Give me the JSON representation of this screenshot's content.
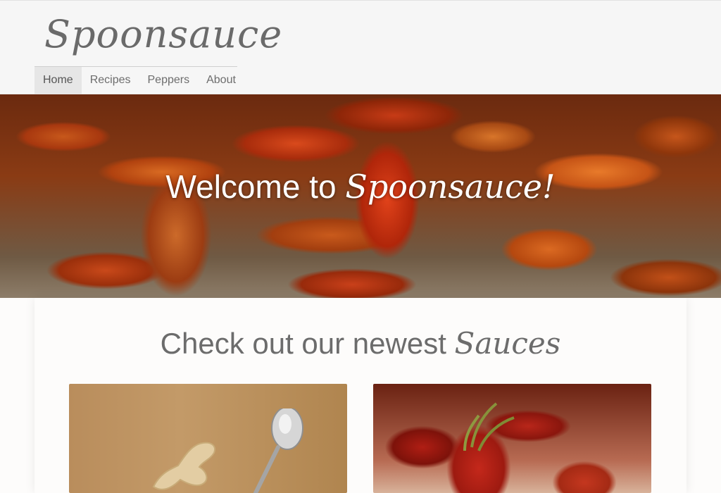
{
  "brand": {
    "logo": "Spoonsauce"
  },
  "nav": {
    "items": [
      {
        "label": "Home",
        "active": true
      },
      {
        "label": "Recipes",
        "active": false
      },
      {
        "label": "Peppers",
        "active": false
      },
      {
        "label": "About",
        "active": false
      }
    ]
  },
  "hero": {
    "title_prefix": "Welcome to",
    "title_script": "Spoonsauce!"
  },
  "section": {
    "title_prefix": "Check out our newest",
    "title_script": "Sauces"
  },
  "colors": {
    "header_bg": "#f6f6f6",
    "nav_active_bg": "#e6e6e6",
    "text": "#6c6c6c"
  },
  "cards": [
    {
      "image": "ginger-and-spoon-photo"
    },
    {
      "image": "red-chili-peppers-photo"
    }
  ]
}
